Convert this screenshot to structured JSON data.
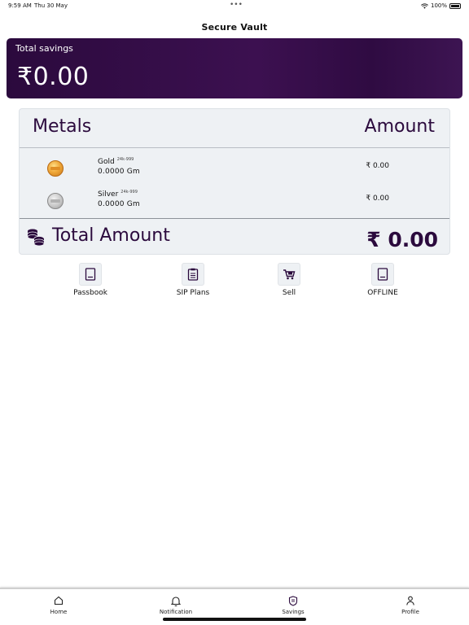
{
  "status_bar": {
    "time": "9:59 AM",
    "date": "Thu 30 May",
    "dots": "•••",
    "battery": "100%"
  },
  "app": {
    "title": "Secure Vault"
  },
  "savings": {
    "label": "Total savings",
    "amount": "₹0.00"
  },
  "metals": {
    "header_left": "Metals",
    "header_right": "Amount",
    "rows": [
      {
        "name": "Gold",
        "purity": "24k-999",
        "quantity": "0.0000  Gm",
        "value": "₹ 0.00"
      },
      {
        "name": "Silver",
        "purity": "24k-999",
        "quantity": "0.0000  Gm",
        "value": "₹ 0.00"
      }
    ],
    "total_label": "Total Amount",
    "total_value": "₹ 0.00"
  },
  "actions": [
    {
      "label": "Passbook",
      "icon": "passbook-icon"
    },
    {
      "label": "SIP Plans",
      "icon": "clipboard-icon"
    },
    {
      "label": "Sell",
      "icon": "cart-icon"
    },
    {
      "label": "OFFLINE",
      "icon": "book-icon"
    }
  ],
  "bottom_nav": [
    {
      "label": "Home",
      "icon": "home-icon"
    },
    {
      "label": "Notification",
      "icon": "bell-icon"
    },
    {
      "label": "Savings",
      "icon": "savings-icon"
    },
    {
      "label": "Profile",
      "icon": "profile-icon"
    }
  ],
  "colors": {
    "brand": "#2b0a3d",
    "card_bg": "#eef1f4"
  }
}
